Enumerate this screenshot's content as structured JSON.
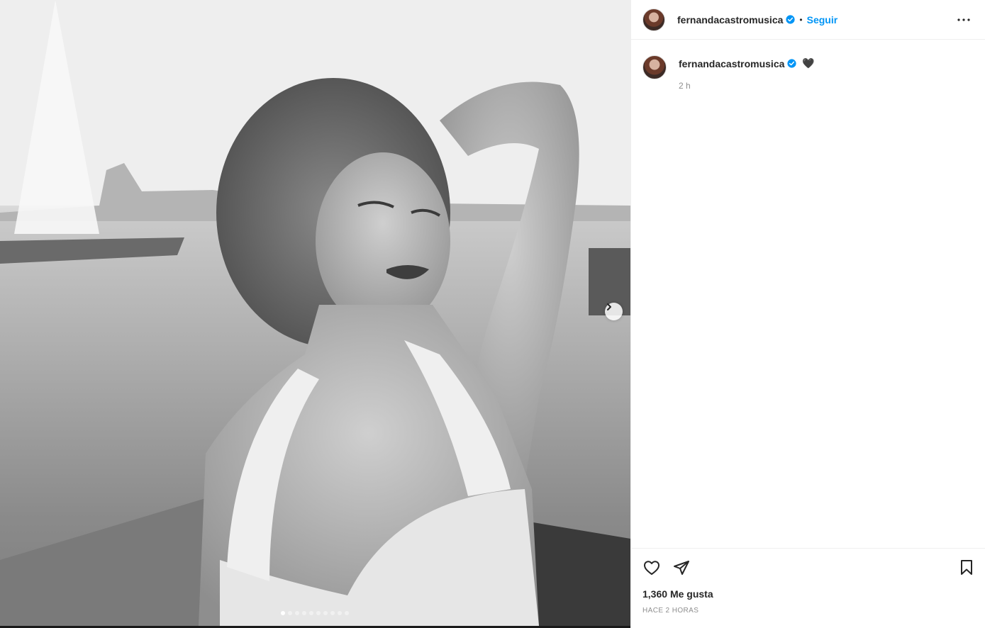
{
  "post": {
    "media_description_icon": "photo",
    "carousel": {
      "total_slides": 10,
      "active_index": 0,
      "next_icon": "chevron-right-icon"
    }
  },
  "header": {
    "username": "fernandacastromusica",
    "verified": true,
    "separator": "•",
    "follow_label": "Seguir",
    "more_icon": "ellipsis-icon"
  },
  "caption": {
    "username": "fernandacastromusica",
    "text": "🖤",
    "time": "2 h"
  },
  "actions": {
    "like_icon": "heart-icon",
    "share_icon": "paper-plane-icon",
    "save_icon": "bookmark-icon"
  },
  "likes": {
    "count": "1,360",
    "label": "Me gusta"
  },
  "posted_ago": "Hace 2 horas",
  "colors": {
    "accent": "#0095f6",
    "verified": "#0095f6",
    "text": "#262626",
    "muted": "#8e8e8e"
  }
}
